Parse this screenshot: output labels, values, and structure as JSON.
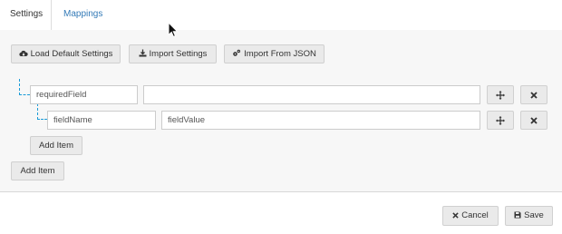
{
  "tabs": [
    {
      "label": "Settings",
      "active": true
    },
    {
      "label": "Mappings",
      "active": false
    }
  ],
  "toolbar": {
    "load_default_label": "Load Default Settings",
    "import_settings_label": "Import Settings",
    "import_json_label": "Import From JSON"
  },
  "tree": {
    "root": {
      "key": "requiredField",
      "value": ""
    },
    "child": {
      "key": "fieldName",
      "value": "fieldValue"
    },
    "add_child_label": "Add Item",
    "add_root_label": "Add Item"
  },
  "footer": {
    "cancel_label": "Cancel",
    "save_label": "Save"
  },
  "colors": {
    "link": "#337ab7",
    "tree_line": "#1a9bd7"
  },
  "icons": [
    "cloud-download-icon",
    "download-icon",
    "gears-icon",
    "move-icon",
    "close-icon",
    "save-icon"
  ]
}
